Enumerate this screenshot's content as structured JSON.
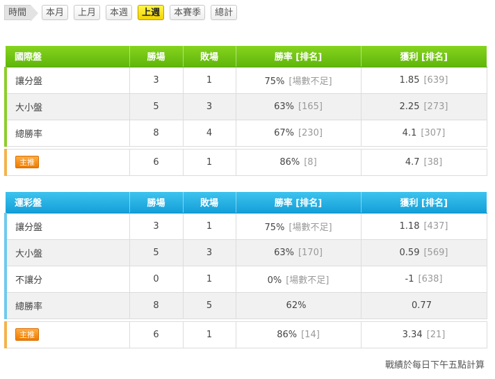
{
  "filter": {
    "label": "時間",
    "options": [
      "本月",
      "上月",
      "本週",
      "上週",
      "本賽季",
      "總計"
    ],
    "active": "上週"
  },
  "headers": {
    "wins": "勝場",
    "losses": "敗場",
    "win_rate": "勝率 [排名]",
    "profit": "獲利 [排名]"
  },
  "tables": {
    "intl": {
      "title": "國際盤",
      "rows": [
        {
          "name": "讓分盤",
          "wins": "3",
          "losses": "1",
          "rate": "75%",
          "rate_rank": "[場數不足]",
          "profit": "1.85",
          "profit_rank": "[639]"
        },
        {
          "name": "大小盤",
          "wins": "5",
          "losses": "3",
          "rate": "63%",
          "rate_rank": "[165]",
          "profit": "2.25",
          "profit_rank": "[273]"
        },
        {
          "name": "總勝率",
          "wins": "8",
          "losses": "4",
          "rate": "67%",
          "rate_rank": "[230]",
          "profit": "4.1",
          "profit_rank": "[307]"
        }
      ],
      "rec": {
        "badge": "主推",
        "wins": "6",
        "losses": "1",
        "rate": "86%",
        "rate_rank": "[8]",
        "profit": "4.7",
        "profit_rank": "[38]"
      }
    },
    "lottery": {
      "title": "運彩盤",
      "rows": [
        {
          "name": "讓分盤",
          "wins": "3",
          "losses": "1",
          "rate": "75%",
          "rate_rank": "[場數不足]",
          "profit": "1.18",
          "profit_rank": "[437]"
        },
        {
          "name": "大小盤",
          "wins": "5",
          "losses": "3",
          "rate": "63%",
          "rate_rank": "[170]",
          "profit": "0.59",
          "profit_rank": "[569]"
        },
        {
          "name": "不讓分",
          "wins": "0",
          "losses": "1",
          "rate": "0%",
          "rate_rank": "[場數不足]",
          "profit": "-1",
          "profit_rank": "[638]"
        },
        {
          "name": "總勝率",
          "wins": "8",
          "losses": "5",
          "rate": "62%",
          "rate_rank": "",
          "profit": "0.77",
          "profit_rank": ""
        }
      ],
      "rec": {
        "badge": "主推",
        "wins": "6",
        "losses": "1",
        "rate": "86%",
        "rate_rank": "[14]",
        "profit": "3.34",
        "profit_rank": "[21]"
      }
    }
  },
  "footnote": "戰績於每日下午五點計算",
  "colors": {
    "intl_header": "#6cc112",
    "lottery_header": "#24b1e4",
    "active_filter": "#f9e21c",
    "badge": "#f58a10"
  }
}
